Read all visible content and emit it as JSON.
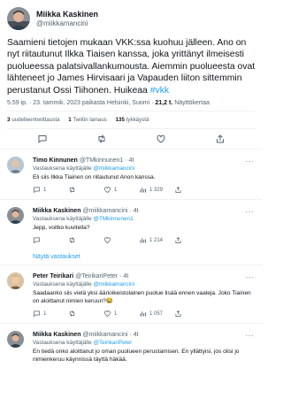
{
  "main_tweet": {
    "author_name": "Miikka Kaskinen",
    "author_handle": "@miikkamancini",
    "text": "Saamieni tietojen mukaan VKK:ssa kuohuu jälleen. Ano on nyt riitautunut Ilkka Tiaisen kanssa, joka yrittänyt ilmeisesti puolueessa palatsivallankumousta. Aiemmin puolueesta ovat lähteneet jo James Hirvisaari ja Vapauden liiton sittemmin perustanut Ossi Tiihonen. Huikeaa",
    "hashtag": "#vkk",
    "time": "5.59 ip.",
    "date": "23. tammik. 2023",
    "location": "paikasta Helsinki, Suomi",
    "views_count": "21,2 t.",
    "views_label": "Näyttökertaa",
    "separator": "·",
    "stats": [
      {
        "count": "3",
        "label": "uudelleentwiittausta"
      },
      {
        "count": "1",
        "label": "Twiitin lainaus"
      },
      {
        "count": "135",
        "label": "tykkäystä"
      }
    ]
  },
  "replies": [
    {
      "author_name": "Timo Kinnunen",
      "author_handle": "@TMkinnunen1",
      "time": "4t",
      "replying_prefix": "Vastauksena käyttäjälle",
      "replying_to": "@miikkamancini",
      "text": "Eli siis Ilkka Tiainen on riitautunut Anon kanssa.",
      "replies_count": "1",
      "retweets_count": "",
      "likes_count": "1",
      "views_count": "1 329"
    },
    {
      "author_name": "Miikka Kaskinen",
      "author_handle": "@miikkamancini",
      "time": "4t",
      "replying_prefix": "Vastauksena käyttäjälle",
      "replying_to": "@TMkinnunen1",
      "text": "Jepp, voitko kuvitella?",
      "replies_count": "",
      "retweets_count": "",
      "likes_count": "",
      "views_count": "1 214"
    },
    {
      "author_name": "Peter Teirikari",
      "author_handle": "@TeirikariPeter",
      "time": "4t",
      "replying_prefix": "Vastauksena käyttäjälle",
      "replying_to": "@miikkamancini",
      "text": "Saadaanko siis vielä yksi äärioikeistolainen puolue lisää ennen vaaleja. Joko Tiainen on aloittanut nimien keruun?😂",
      "replies_count": "1",
      "retweets_count": "",
      "likes_count": "1",
      "views_count": "1 057"
    },
    {
      "author_name": "Miikka Kaskinen",
      "author_handle": "@miikkamancini",
      "time": "4t",
      "replying_prefix": "Vastauksena käyttäjälle",
      "replying_to": "@TeirikariPeter",
      "text": "En tiedä onko aloittanut jo oman puolueen perustamisen. En yllättyisi, jos olisi jo nimienkeruu käynnissä täyttä häkää."
    }
  ],
  "show_replies_label": "Näytä vastaukset",
  "more_label": "···",
  "colors": {
    "accent": "#1d9bf0",
    "text": "#0f1419",
    "muted": "#536471",
    "divider": "#eff3f4"
  },
  "icons": [
    "reply-icon",
    "retweet-icon",
    "like-icon",
    "share-icon",
    "views-icon",
    "verified-icon"
  ]
}
